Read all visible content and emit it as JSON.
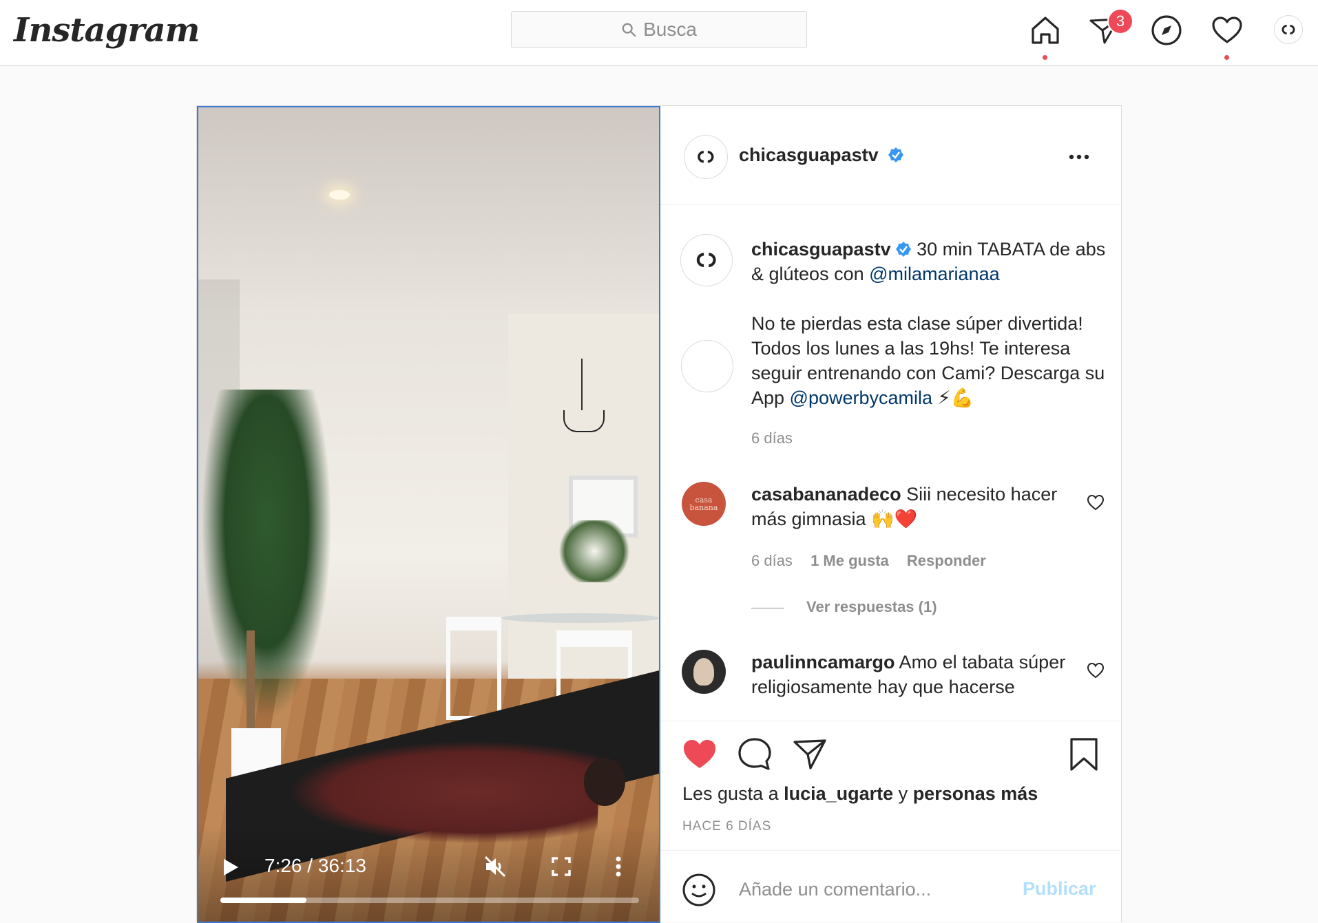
{
  "nav": {
    "logo": "Instagram",
    "search_placeholder": "Busca",
    "messages_badge": "3",
    "icons": [
      "home-icon",
      "direct-icon",
      "explore-icon",
      "activity-icon",
      "profile-avatar"
    ],
    "accent": "#ed4956"
  },
  "post": {
    "author": "chicasguapastv",
    "verified": true,
    "video": {
      "time": "7:26 / 36:13",
      "progress_fraction": 0.205,
      "muted": true
    },
    "caption": {
      "part1": " 30 min TABATA de abs & glúteos con ",
      "mention1": "@milamarianaa",
      "part2": "No te pierdas esta clase súper divertida! Todos los lunes a las 19hs! Te interesa seguir entrenando con Cami? Descarga su App ",
      "mention2": "@powerbycamila",
      "emoji": " ⚡💪",
      "age": "6 días"
    },
    "comments": [
      {
        "user": "casabananadeco",
        "avatar_text": "casa banana",
        "text": " Siii necesito hacer más gimnasia 🙌❤️",
        "age": "6 días",
        "likes": "1 Me gusta",
        "reply": "Responder",
        "view_replies": "Ver respuestas (1)"
      },
      {
        "user": "paulinncamargo",
        "text": " Amo el tabata súper religiosamente hay que hacerse"
      }
    ],
    "likes": {
      "prefix": "Les gusta a ",
      "user": "lucia_ugarte",
      "middle": " y ",
      "others": "personas más"
    },
    "timestamp": "HACE 6 DÍAS",
    "add_comment_placeholder": "Añade un comentario...",
    "publish_label": "Publicar"
  },
  "colors": {
    "like_red": "#ed4956",
    "link_blue": "#00376b",
    "verified_blue": "#3897f0",
    "publish_disabled": "#b2dffc"
  }
}
